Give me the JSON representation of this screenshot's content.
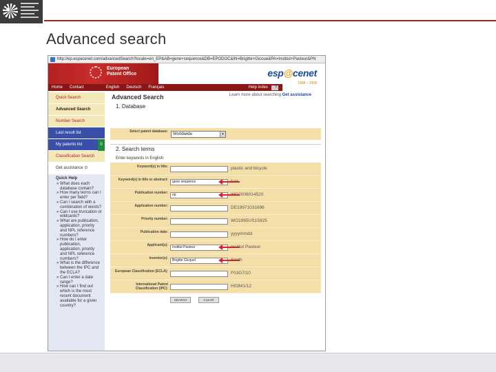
{
  "slide": {
    "title": "Advanced search"
  },
  "browser": {
    "url": "http://ep.espacenet.com/advancedSearch?locale=en_EP&AB=gene+sequence&DB=EPODOC&IN=Brigitte+Gicoue&PA=Institut+Pasteur&PN"
  },
  "header": {
    "org_name_line1": "European",
    "org_name_line2": "Patent Office",
    "nav_links": [
      "Home",
      "Contact",
      "English",
      "Deutsch",
      "Français"
    ],
    "help_index": "Help index",
    "help_icon_label": "?",
    "brand": {
      "pre": "esp",
      "mid": "@",
      "post": "cenet"
    },
    "brand_years": "1998 – 2008",
    "learn_text": "Learn more about searching",
    "learn_link": "Get assistance"
  },
  "leftnav": {
    "items": [
      {
        "label": "Quick Search",
        "style": "normal"
      },
      {
        "label": "Advanced Search",
        "style": "active"
      },
      {
        "label": "Number Search",
        "style": "normal"
      },
      {
        "label": "Last result list",
        "style": "blue"
      },
      {
        "label": "My patents list",
        "style": "blue",
        "count": "0"
      },
      {
        "label": "Classification Search",
        "style": "normal"
      },
      {
        "label": "Get assistance ⊙",
        "style": "plain"
      }
    ],
    "help_title": "Quick Help",
    "help_questions": [
      "» What does each database contain?",
      "» How many terms can I enter per field?",
      "» Can I search with a combination of words?",
      "» Can I use truncation or wildcards?",
      "» What are publication, application, priority and NPL reference numbers?",
      "» How do I enter publication, application, priority and NPL reference numbers?",
      "» What is the difference between the IPC and the ECLA?",
      "» Can I enter a date range?",
      "» How can I find out which is the most recent document available for a given country?"
    ]
  },
  "content": {
    "page_heading": "Advanced Search",
    "section1": "1. Database",
    "db_label": "Select patent database:",
    "db_value": "Worldwide",
    "section2": "2. Search terms",
    "keywords_note": "Enter keywords in English",
    "fields": [
      {
        "label": "Keyword(s) in title:",
        "value": "",
        "example": "plastic and bicycle"
      },
      {
        "label": "Keyword(s) in title or abstract:",
        "value": "gene sequence",
        "example": "hair"
      },
      {
        "label": "Publication number:",
        "value": "ep",
        "example": "WO2008014520"
      },
      {
        "label": "Application number:",
        "value": "",
        "example": "DE19971031696"
      },
      {
        "label": "Priority number:",
        "value": "",
        "example": "WO1995US15925"
      },
      {
        "label": "Publication date:",
        "value": "",
        "example": "yyyymmdd"
      },
      {
        "label": "Applicant(s):",
        "value": "Institut Pasteur",
        "example": "Institut Pasteur"
      },
      {
        "label": "Inventor(s):",
        "value": "Brigitte Gicquel",
        "example": "Smith"
      },
      {
        "label": "European Classification (ECLA):",
        "value": "",
        "example": "F03G7/10"
      },
      {
        "label": "International Patent Classification (IPC):",
        "value": "",
        "example": "H03M1/12"
      }
    ],
    "search_button": "SEARCH",
    "clear_button": "CLEAR"
  },
  "colors": {
    "accent_red": "#b71c1c",
    "nav_bg": "#f3e8b8",
    "form_bg": "#f5dfa8",
    "annotation_arrow": "#e02020"
  }
}
